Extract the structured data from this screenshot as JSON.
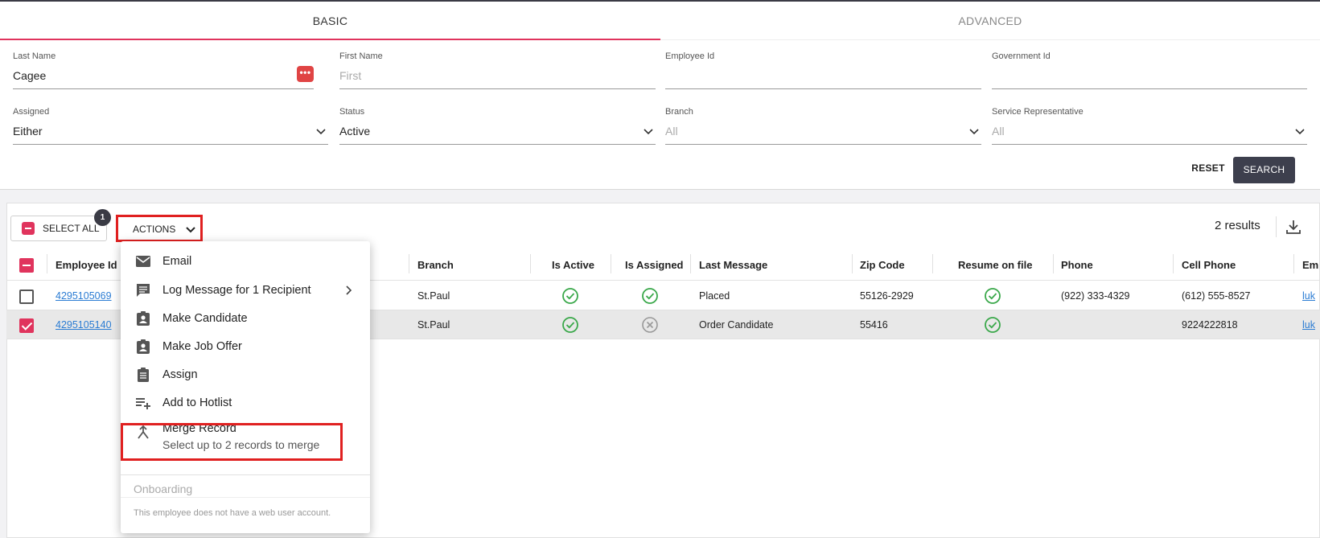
{
  "tabs": {
    "basic": "BASIC",
    "advanced": "ADVANCED"
  },
  "filters": {
    "last_name": {
      "label": "Last Name",
      "value": "Cagee"
    },
    "first_name": {
      "label": "First Name",
      "placeholder": "First"
    },
    "employee_id": {
      "label": "Employee Id",
      "value": ""
    },
    "government_id": {
      "label": "Government Id",
      "value": ""
    },
    "assigned": {
      "label": "Assigned",
      "value": "Either"
    },
    "status": {
      "label": "Status",
      "value": "Active"
    },
    "branch": {
      "label": "Branch",
      "placeholder": "All"
    },
    "service_rep": {
      "label": "Service Representative",
      "placeholder": "All"
    },
    "dots": "•••"
  },
  "buttons": {
    "reset": "RESET",
    "search": "SEARCH"
  },
  "toolbar": {
    "select_all": "SELECT ALL",
    "selected_count": "1",
    "actions": "ACTIONS",
    "results": "2 results"
  },
  "table": {
    "headers": {
      "employee_id": "Employee Id",
      "branch": "Branch",
      "is_active": "Is Active",
      "is_assigned": "Is Assigned",
      "last_message": "Last Message",
      "zip": "Zip Code",
      "resume": "Resume on file",
      "phone": "Phone",
      "cell": "Cell Phone",
      "email": "Em"
    },
    "rows": [
      {
        "employee_id": "4295105069",
        "branch": "St.Paul",
        "is_active": "yes",
        "is_assigned": "yes",
        "last_message": "Placed",
        "zip": "55126-2929",
        "resume": "yes",
        "phone": "(922) 333-4329",
        "cell": "(612) 555-8527",
        "email": "luk",
        "selected": false
      },
      {
        "employee_id": "4295105140",
        "branch": "St.Paul",
        "is_active": "yes",
        "is_assigned": "no",
        "last_message": "Order Candidate",
        "zip": "55416",
        "resume": "yes",
        "phone": "",
        "cell": "9224222818",
        "email": "luk",
        "selected": true
      }
    ]
  },
  "menu": {
    "email": "Email",
    "log_message": "Log Message for 1 Recipient",
    "make_candidate": "Make Candidate",
    "make_job_offer": "Make Job Offer",
    "assign": "Assign",
    "add_hotlist": "Add to Hotlist",
    "merge_record": "Merge Record",
    "merge_hint": "Select up to 2 records to merge",
    "onboarding": "Onboarding",
    "onboarding_note": "This employee does not have a web user account."
  },
  "colors": {
    "accent": "#e0345d",
    "highlight": "#e02020",
    "dark": "#3a3b45",
    "check_green": "#3aa84a",
    "link": "#2b7cd3"
  }
}
